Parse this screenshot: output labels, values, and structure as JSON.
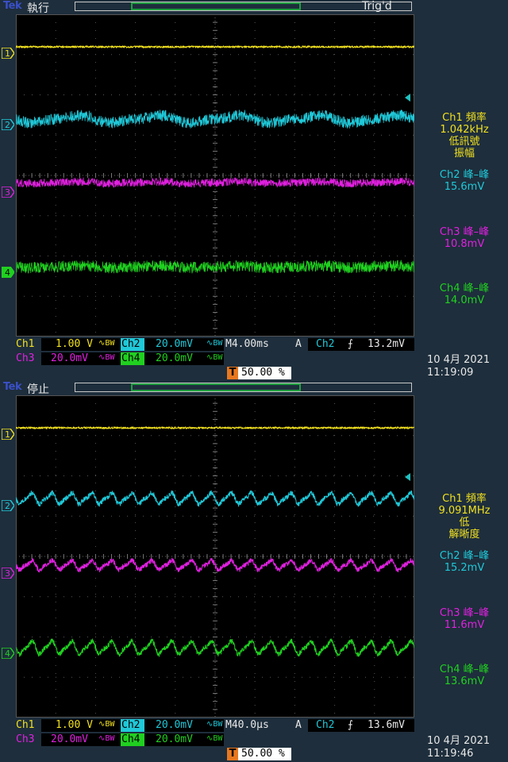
{
  "colors": {
    "ch1": "#f0e020",
    "ch2": "#20c8d8",
    "ch3": "#e020e0",
    "ch4": "#20d020",
    "trigger": "#e87820",
    "text": "#e8e8e8"
  },
  "brand": "Tek",
  "screens": [
    {
      "run_state": "執行",
      "trig_status": "Trig'd",
      "channel_markers": [
        "1",
        "2",
        "3",
        "4"
      ],
      "trigger_marker": "T",
      "measurements": [
        {
          "lines": [
            "Ch1 頻率",
            "1.042kHz",
            "低訊號",
            "振幅"
          ]
        },
        {
          "lines": [
            "Ch2 峰–峰",
            "15.6mV"
          ]
        },
        {
          "lines": [
            "Ch3 峰–峰",
            "10.8mV"
          ]
        },
        {
          "lines": [
            "Ch4 峰–峰",
            "14.0mV"
          ]
        }
      ],
      "settings": {
        "ch1_label": "Ch1",
        "ch1_scale": "1.00 V",
        "ch2_label": "Ch2",
        "ch2_scale": "20.0mV",
        "ch3_label": "Ch3",
        "ch3_scale": "20.0mV",
        "ch4_label": "Ch4",
        "ch4_scale": "20.0mV",
        "bw_symbol": "∿BW",
        "timebase": "M4.00ms",
        "acq_mode": "A",
        "trig_source": "Ch2",
        "trig_slope": "⨍",
        "trig_level": "13.2mV",
        "trig_position": "50.00 %",
        "date": "10 4月  2021",
        "time": "11:19:09"
      },
      "waves": {
        "ch2_ripple_cycles": 5,
        "ch3_ripple_cycles": 5,
        "ch4_ripple_cycles": 5
      }
    },
    {
      "run_state": "停止",
      "trig_status": "",
      "channel_markers": [
        "1",
        "2",
        "3",
        "4"
      ],
      "trigger_marker": "T",
      "measurements": [
        {
          "lines": [
            "Ch1 頻率",
            "9.091MHz",
            "低",
            "解晰度"
          ]
        },
        {
          "lines": [
            "Ch2 峰–峰",
            "15.2mV"
          ]
        },
        {
          "lines": [
            "Ch3 峰–峰",
            "11.6mV"
          ]
        },
        {
          "lines": [
            "Ch4 峰–峰",
            "13.6mV"
          ]
        }
      ],
      "settings": {
        "ch1_label": "Ch1",
        "ch1_scale": "1.00 V",
        "ch2_label": "Ch2",
        "ch2_scale": "20.0mV",
        "ch3_label": "Ch3",
        "ch3_scale": "20.0mV",
        "ch4_label": "Ch4",
        "ch4_scale": "20.0mV",
        "bw_symbol": "∿BW",
        "timebase": "M40.0µs",
        "acq_mode": "A",
        "trig_source": "Ch2",
        "trig_slope": "⨍",
        "trig_level": "13.6mV",
        "trig_position": "50.00 %",
        "date": "10 4月  2021",
        "time": "11:19:46"
      },
      "waves": {
        "ch2_ripple_cycles": 20,
        "ch3_ripple_cycles": 20,
        "ch4_ripple_cycles": 20
      }
    }
  ]
}
